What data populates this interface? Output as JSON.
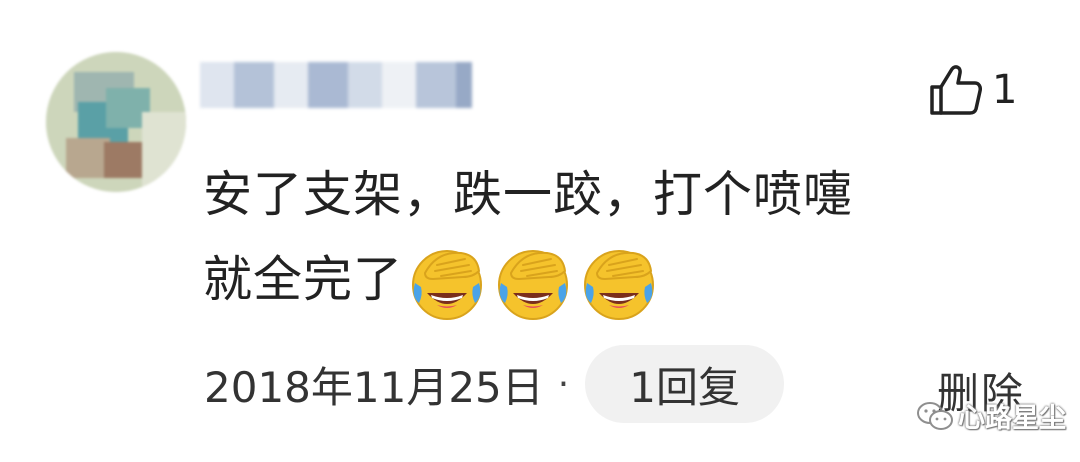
{
  "comment": {
    "username_hidden": true,
    "lines": [
      "安了支架，跌一跤，打个喷嚏",
      "就全完了"
    ],
    "emoji": [
      "facepalm-cry-emoji",
      "facepalm-cry-emoji",
      "facepalm-cry-emoji"
    ],
    "like_count": "1",
    "date": "2018年11月25日",
    "separator": "·",
    "reply_label": "1回复",
    "delete_label": "删除"
  },
  "watermark": {
    "text": "心路星尘",
    "icon": "wechat-icon"
  },
  "colors": {
    "text": "#222222",
    "reply_bg": "#f1f1f1",
    "emoji_yellow": "#f5c32c",
    "tear_blue": "#4aa3e8"
  }
}
